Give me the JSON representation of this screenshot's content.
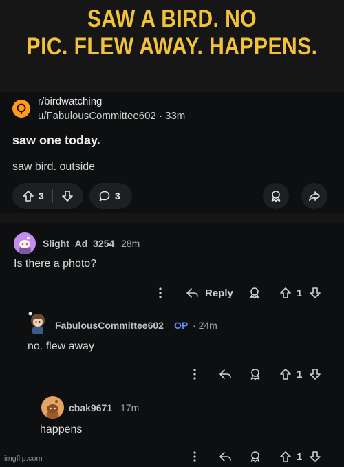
{
  "meme": {
    "caption": "SAW A BIRD. NO PIC. FLEW AWAY. HAPPENS.",
    "caption_line1": "SAW A BIRD. NO",
    "caption_line2": "PIC. FLEW AWAY. HAPPENS.",
    "watermark": "imgflip.com"
  },
  "post": {
    "subreddit": "r/birdwatching",
    "author": "u/FabulousCommittee602",
    "time": "33m",
    "title": "saw one today.",
    "body": "saw bird. outside",
    "upvotes": "3",
    "comments": "3",
    "icons": [
      "upvote-icon",
      "downvote-icon",
      "comment-icon",
      "award-icon",
      "share-icon"
    ]
  },
  "comments": [
    {
      "author": "Slight_Ad_3254",
      "time": "28m",
      "text": "Is there a photo?",
      "reply_label": "Reply",
      "votes": "1"
    },
    {
      "author": "FabulousCommittee602",
      "op_badge": "OP",
      "time": "24m",
      "text": "no. flew away",
      "votes": "1"
    },
    {
      "author": "cbak9671",
      "time": "17m",
      "text": "happens",
      "votes": "1"
    }
  ],
  "colors": {
    "caption": "#f2c23a",
    "subreddit_icon": "#ff9a1a",
    "op_badge": "#6a8cff"
  }
}
